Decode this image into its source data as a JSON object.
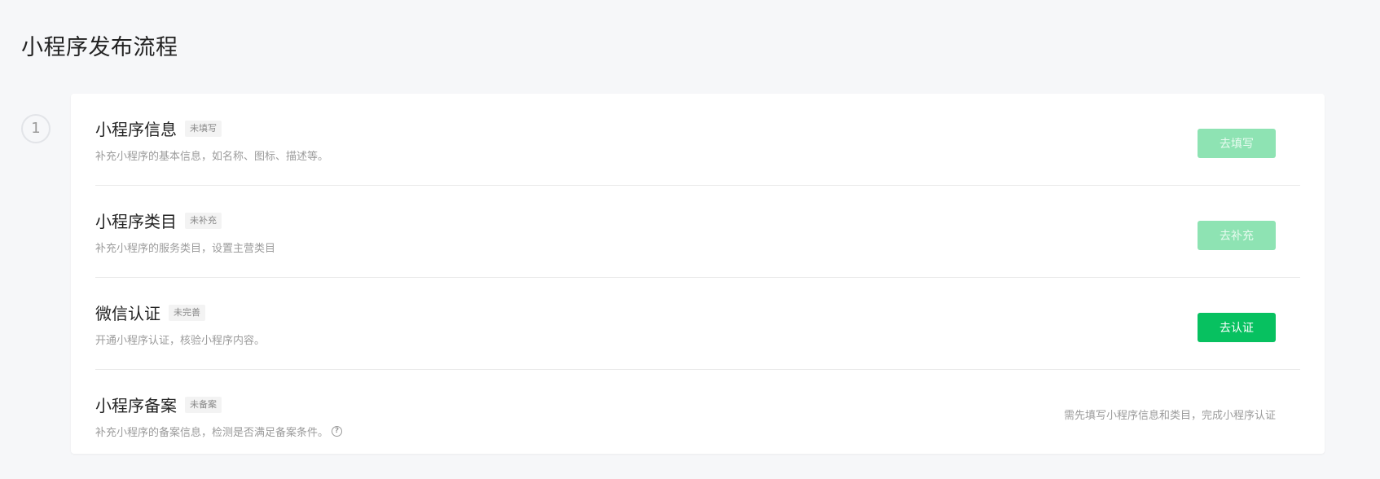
{
  "page": {
    "title": "小程序发布流程",
    "step_number": "1"
  },
  "steps": [
    {
      "title": "小程序信息",
      "badge": "未填写",
      "description": "补充小程序的基本信息，如名称、图标、描述等。",
      "action_label": "去填写",
      "action_state": "disabled"
    },
    {
      "title": "小程序类目",
      "badge": "未补充",
      "description": "补充小程序的服务类目，设置主营类目",
      "action_label": "去补充",
      "action_state": "disabled"
    },
    {
      "title": "微信认证",
      "badge": "未完善",
      "description": "开通小程序认证，核验小程序内容。",
      "action_label": "去认证",
      "action_state": "enabled"
    },
    {
      "title": "小程序备案",
      "badge": "未备案",
      "description": "补充小程序的备案信息，检测是否满足备案条件。",
      "help_icon": "question-circle-icon",
      "note": "需先填写小程序信息和类目，完成小程序认证"
    }
  ],
  "colors": {
    "primary_green": "#07c160",
    "disabled_green": "#8ee3b3",
    "page_background": "#f6f7f9"
  }
}
